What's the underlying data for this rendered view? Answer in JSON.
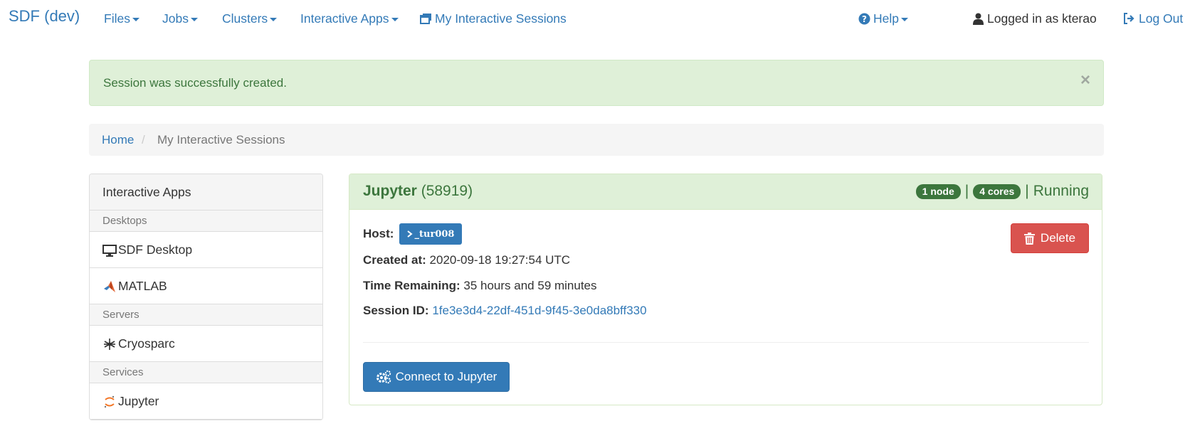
{
  "navbar": {
    "brand": "SDF (dev)",
    "files": "Files",
    "jobs": "Jobs",
    "clusters": "Clusters",
    "interactive_apps": "Interactive Apps",
    "my_sessions": "My Interactive Sessions",
    "help": "Help",
    "logged_in": "Logged in as kterao",
    "logout": "Log Out"
  },
  "alert": {
    "message": "Session was successfully created.",
    "close": "×"
  },
  "breadcrumb": {
    "home": "Home",
    "separator": "/",
    "current": "My Interactive Sessions"
  },
  "sidebar": {
    "title": "Interactive Apps",
    "categories": [
      {
        "label": "Desktops",
        "items": [
          {
            "label": "SDF Desktop",
            "icon": "desktop-icon"
          },
          {
            "label": "MATLAB",
            "icon": "matlab-icon"
          }
        ]
      },
      {
        "label": "Servers",
        "items": [
          {
            "label": "Cryosparc",
            "icon": "cryosparc-icon"
          }
        ]
      },
      {
        "label": "Services",
        "items": [
          {
            "label": "Jupyter",
            "icon": "jupyter-icon"
          }
        ]
      }
    ]
  },
  "session": {
    "app_name": "Jupyter",
    "job_id": "(58919)",
    "nodes_badge": "1 node",
    "cores_badge": "4 cores",
    "separator": "|",
    "status": "Running",
    "host_label": "Host:",
    "host_value": "_tur008",
    "created_label": "Created at:",
    "created_value": "2020-09-18 19:27:54 UTC",
    "remaining_label": "Time Remaining:",
    "remaining_value": "35 hours and 59 minutes",
    "session_id_label": "Session ID:",
    "session_id_value": "1fe3e3d4-22df-451d-9f45-3e0da8bff330",
    "delete_label": "Delete",
    "connect_label": "Connect to Jupyter"
  },
  "colors": {
    "link": "#337ab7",
    "success_bg": "#dff0d8",
    "success_text": "#3c763d",
    "danger": "#d9534f"
  }
}
